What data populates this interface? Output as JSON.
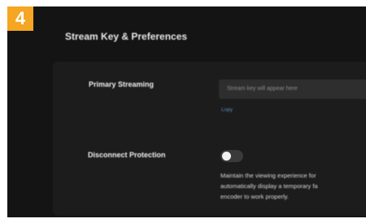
{
  "step": {
    "number": "4"
  },
  "page": {
    "title": "Stream Key & Preferences"
  },
  "primary": {
    "label": "Primary Streaming",
    "field_value": "Stream key will appear here",
    "link": "Copy"
  },
  "protection": {
    "label": "Disconnect Protection",
    "toggle_on": false,
    "desc_line1": "Maintain the viewing experience for",
    "desc_line2": "automatically display a temporary fa",
    "desc_line3": "encoder to work properly."
  },
  "colors": {
    "badge": "#f5a623",
    "background": "#141414",
    "card": "#1c1c1c",
    "field": "#2e2e2e",
    "link": "#5d8fc4"
  }
}
